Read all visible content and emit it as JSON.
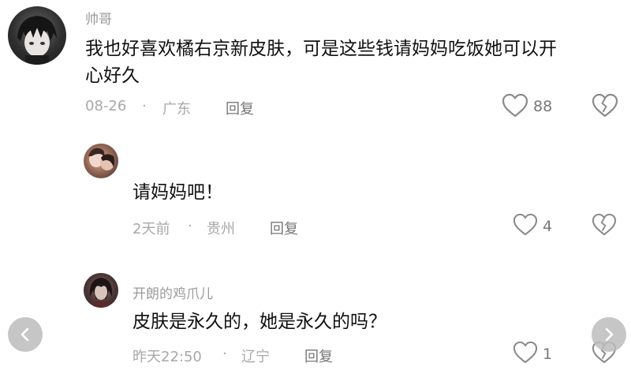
{
  "comments": [
    {
      "username": "帅哥",
      "text_line1": "我也好喜欢橘右京新皮肤，可是这些钱请妈妈吃饭她可以开",
      "text_line2": "心好久",
      "date": "08-26",
      "separator": "·",
      "location": "广东",
      "reply_label": "回复",
      "likes": "88"
    },
    {
      "text": "请妈妈吧！",
      "date": "2天前",
      "separator": "·",
      "location": "贵州",
      "reply_label": "回复",
      "likes": "4"
    },
    {
      "username": "开朗的鸡爪儿",
      "text": "皮肤是永久的，她是永久的吗？",
      "date": "昨天22:50",
      "separator": "·",
      "location": "辽宁",
      "reply_label": "回复",
      "likes": "1"
    }
  ],
  "icons": {
    "like": "heart-outline-icon",
    "dislike": "broken-heart-icon",
    "prev": "chevron-left-icon",
    "next": "chevron-right-icon"
  },
  "colors": {
    "meta_text": "#a8a8a8",
    "body_text": "#111111",
    "nav_button": "#bdbdbd"
  }
}
